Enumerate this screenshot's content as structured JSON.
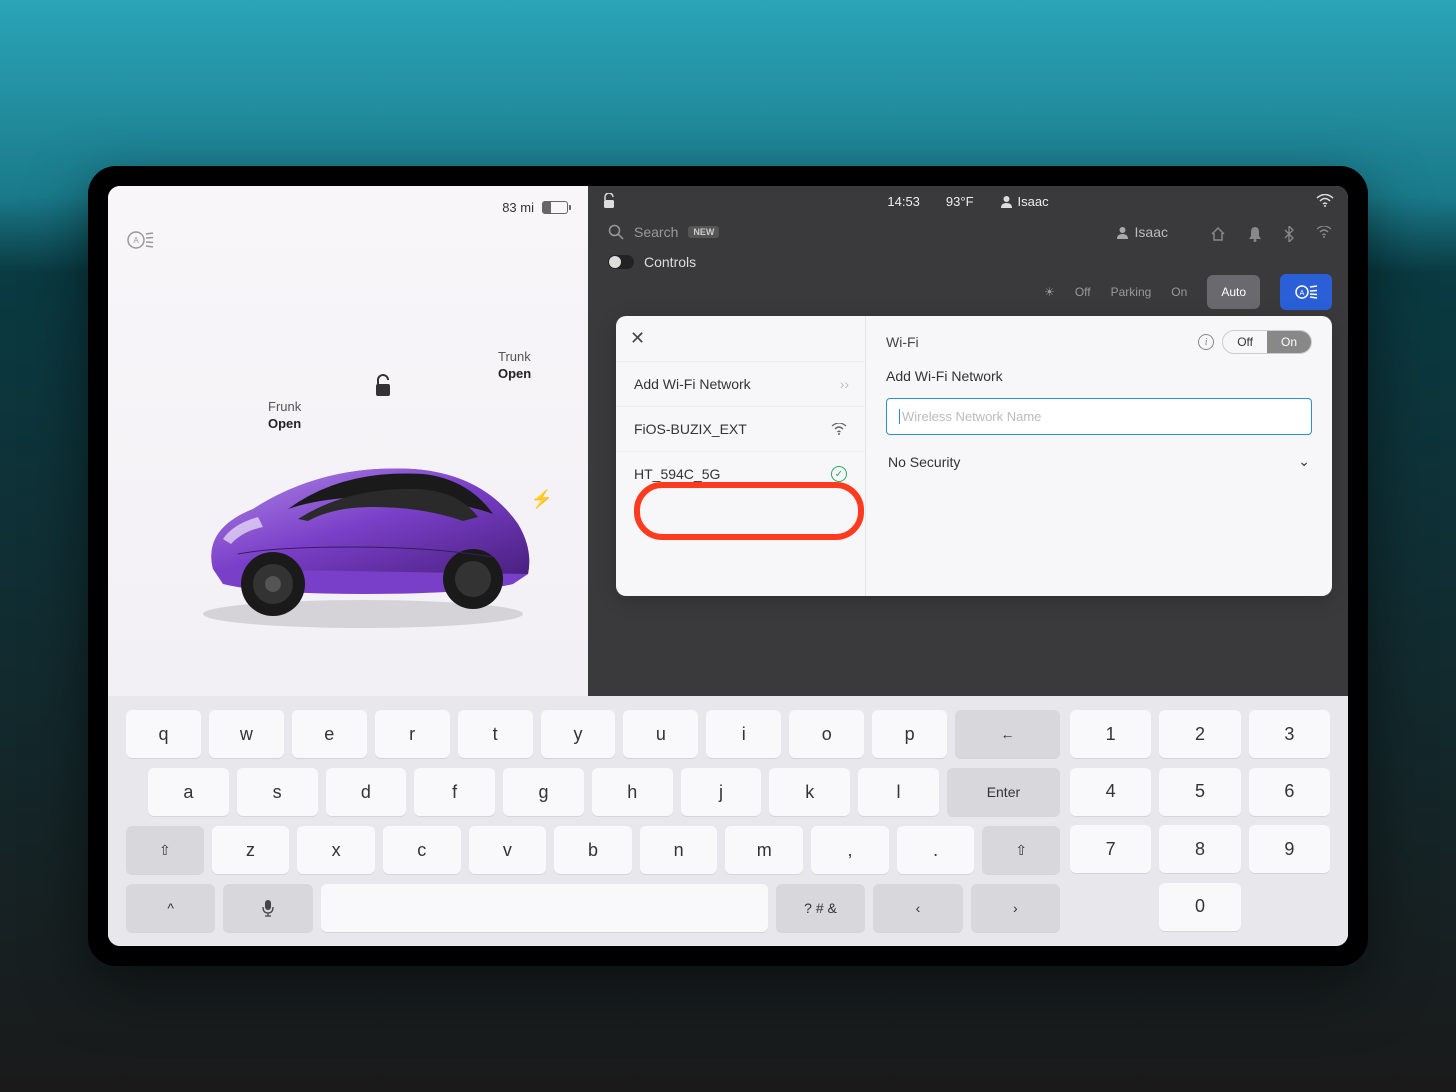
{
  "left": {
    "range": "83 mi",
    "frunk": {
      "label": "Frunk",
      "state": "Open"
    },
    "trunk": {
      "label": "Trunk",
      "state": "Open"
    }
  },
  "status_bar": {
    "time": "14:53",
    "temperature": "93°F",
    "profile_name": "Isaac"
  },
  "right": {
    "search_label": "Search",
    "new_badge": "NEW",
    "profile_name": "Isaac",
    "controls_label": "Controls",
    "lights": {
      "off": "Off",
      "parking": "Parking",
      "on": "On",
      "auto": "Auto"
    }
  },
  "wifi": {
    "title": "Wi-Fi",
    "off_label": "Off",
    "on_label": "On",
    "add_network_label": "Add Wi-Fi Network",
    "networks": [
      {
        "ssid": "FiOS-BUZIX_EXT"
      },
      {
        "ssid": "HT_594C_5G"
      }
    ],
    "right_add_label": "Add Wi-Fi Network",
    "placeholder": "Wireless Network Name",
    "security_label": "No Security"
  },
  "keyboard": {
    "row1": [
      "q",
      "w",
      "e",
      "r",
      "t",
      "y",
      "u",
      "i",
      "o",
      "p"
    ],
    "row2": [
      "a",
      "s",
      "d",
      "f",
      "g",
      "h",
      "j",
      "k",
      "l"
    ],
    "row3": [
      "z",
      "x",
      "c",
      "v",
      "b",
      "n",
      "m",
      ",",
      "."
    ],
    "backspace": "←",
    "enter": "Enter",
    "symbols": "? # &",
    "numpad": [
      "1",
      "2",
      "3",
      "4",
      "5",
      "6",
      "7",
      "8",
      "9",
      "",
      "0",
      ""
    ]
  }
}
